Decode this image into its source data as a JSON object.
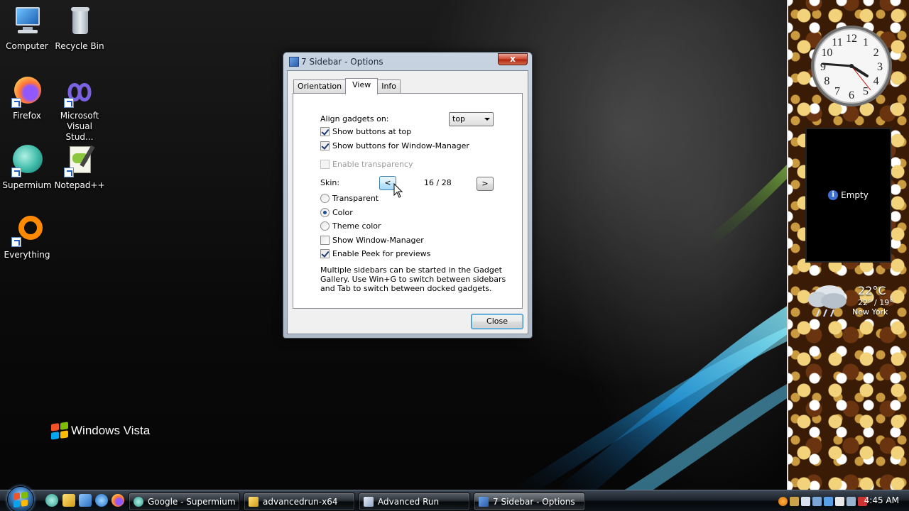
{
  "desktop": {
    "icons": [
      {
        "label": "Computer"
      },
      {
        "label": "Recycle Bin"
      },
      {
        "label": "Firefox"
      },
      {
        "label": "Microsoft Visual Stud..."
      },
      {
        "label": "Supermium"
      },
      {
        "label": "Notepad++"
      },
      {
        "label": "Everything"
      }
    ],
    "brand": "Windows Vista"
  },
  "dialog": {
    "title": "7 Sidebar - Options",
    "close_glyph": "x",
    "tabs": [
      {
        "label": "Orientation",
        "active": false
      },
      {
        "label": "View",
        "active": true
      },
      {
        "label": "Info",
        "active": false
      }
    ],
    "align_label": "Align gadgets on:",
    "align_value": "top",
    "show_buttons_top": {
      "label": "Show buttons at top",
      "checked": true
    },
    "show_buttons_wm": {
      "label": "Show buttons for Window-Manager",
      "checked": true
    },
    "enable_transparency": {
      "label": "Enable transparency",
      "checked": false,
      "disabled": true
    },
    "skin_label": "Skin:",
    "skin_prev": "<",
    "skin_counter": "16 / 28",
    "skin_next": ">",
    "radio_transparent": {
      "label": "Transparent",
      "selected": false
    },
    "radio_color": {
      "label": "Color",
      "selected": true
    },
    "radio_theme": {
      "label": "Theme color",
      "selected": false
    },
    "show_wm": {
      "label": "Show Window-Manager",
      "checked": false
    },
    "enable_peek": {
      "label": "Enable Peek for previews",
      "checked": true
    },
    "info_text": "Multiple sidebars can be started in the Gadget Gallery. Use Win+G to switch between sidebars and Tab to switch between docked gadgets.",
    "close_label": "Close"
  },
  "sidebar": {
    "clock_numbers": [
      "12",
      "1",
      "2",
      "3",
      "4",
      "5",
      "6",
      "7",
      "8",
      "9",
      "10",
      "11"
    ],
    "empty_label": "Empty",
    "weather": {
      "temp": "22°C",
      "range": "22° / 19°",
      "city": "New York"
    }
  },
  "taskbar": {
    "tasks": [
      {
        "label": "Google - Supermium",
        "active": false
      },
      {
        "label": "advancedrun-x64",
        "active": false
      },
      {
        "label": "Advanced Run",
        "active": false
      },
      {
        "label": "7 Sidebar - Options",
        "active": true
      }
    ],
    "time": "4:45 AM"
  },
  "colors": {
    "accent": "#3c7fb1",
    "close_red": "#c4391f",
    "info_blue": "#3f6fd0"
  }
}
